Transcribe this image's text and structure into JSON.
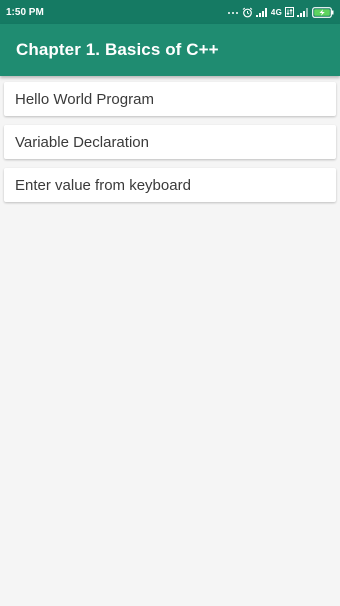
{
  "status_bar": {
    "time": "1:50 PM",
    "network_label": "4G",
    "battery_icon": "battery-charging-icon",
    "colors": {
      "background": "#157a63",
      "text": "#ffffff"
    }
  },
  "app_bar": {
    "title": "Chapter 1. Basics of C++",
    "colors": {
      "background": "#1f8c71",
      "text": "#ffffff"
    }
  },
  "list": {
    "items": [
      {
        "label": "Hello World Program"
      },
      {
        "label": "Variable Declaration"
      },
      {
        "label": "Enter value from keyboard"
      }
    ]
  }
}
